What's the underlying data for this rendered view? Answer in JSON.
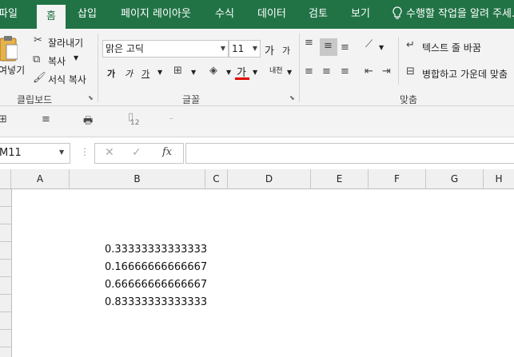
{
  "tabs": {
    "file": "파일",
    "home": "홈",
    "insert": "삽입",
    "page_layout": "페이지 레이아웃",
    "formulas": "수식",
    "data": "데이터",
    "review": "검토",
    "view": "보기",
    "tell_me": "수행할 작업을 알려 주세..."
  },
  "ribbon": {
    "clipboard": {
      "paste": "여넣기",
      "cut": "잘라내기",
      "copy": "복사",
      "format_painter": "서식 복사",
      "group_label": "클립보드"
    },
    "font": {
      "name": "맑은 고딕",
      "size": "11",
      "grow": "가",
      "shrink": "가",
      "bold": "가",
      "italic": "가",
      "underline": "가",
      "font_color": "가",
      "phonetic": "내천",
      "group_label": "글꼴"
    },
    "alignment": {
      "wrap_text": "텍스트 줄 바꿈",
      "merge_center": "병합하고 가운데 맞춤",
      "group_label": "맞춤"
    }
  },
  "qat": {
    "badge": "12"
  },
  "formula_bar": {
    "name_box": "M11",
    "fx": "fx",
    "value": ""
  },
  "columns": [
    "A",
    "B",
    "C",
    "D",
    "E",
    "F",
    "G",
    "H"
  ],
  "cells": [
    "0.33333333333333",
    "0.16666666666667",
    "0.66666666666667",
    "0.83333333333333"
  ],
  "colors": {
    "brand": "#217346",
    "font_color_bar": "#e00000"
  }
}
